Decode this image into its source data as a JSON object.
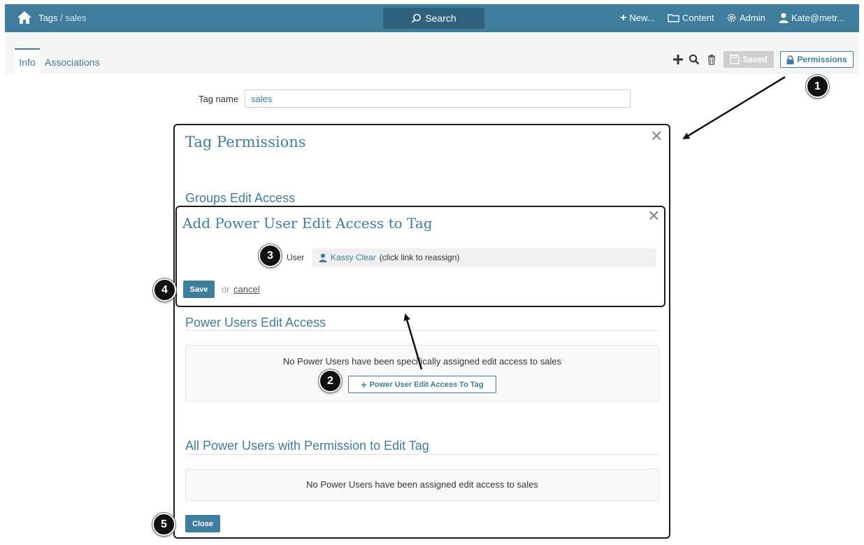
{
  "header": {
    "breadcrumb_root": "Tags",
    "breadcrumb_sep": " / ",
    "breadcrumb_current": "sales",
    "search_label": "Search",
    "new_label": "New...",
    "content_label": "Content",
    "admin_label": "Admin",
    "user_label": "Kate@metr..."
  },
  "tabs": [
    {
      "label": "Info",
      "active": true
    },
    {
      "label": "Associations",
      "active": false
    }
  ],
  "toolbar": {
    "saved_label": "Saved",
    "permissions_label": "Permissions"
  },
  "form": {
    "tag_name_label": "Tag name",
    "tag_name_value": "sales"
  },
  "permissions_modal": {
    "title": "Tag Permissions",
    "groups_heading": "Groups Edit Access",
    "power_users_heading": "Power Users Edit Access",
    "power_users_empty": "No Power Users have been specifically assigned edit access to sales",
    "add_power_user_button": "Power User Edit Access To Tag",
    "all_power_users_heading": "All Power Users with Permission to Edit Tag",
    "all_power_users_empty": "No Power Users have been assigned edit access to sales",
    "close_button": "Close"
  },
  "add_dialog": {
    "title": "Add Power User Edit Access to Tag",
    "user_label": "User",
    "user_name": "Kassy Clear",
    "user_hint": "(click link to reassign)",
    "save_button": "Save",
    "or_text": "or",
    "cancel_link": "cancel"
  },
  "callouts": [
    "1",
    "2",
    "3",
    "4",
    "5"
  ],
  "colors": {
    "brand": "#3e7d9c",
    "navbar": "#3e7d9c",
    "search_button": "#2e627c"
  },
  "icons": {
    "home": "home-icon",
    "search": "search-icon",
    "plus": "plus-icon",
    "content": "folder-icon",
    "admin": "gear-icon",
    "user": "user-icon",
    "trash": "trash-icon",
    "save": "floppy-icon",
    "lock": "lock-icon",
    "close": "close-icon"
  }
}
